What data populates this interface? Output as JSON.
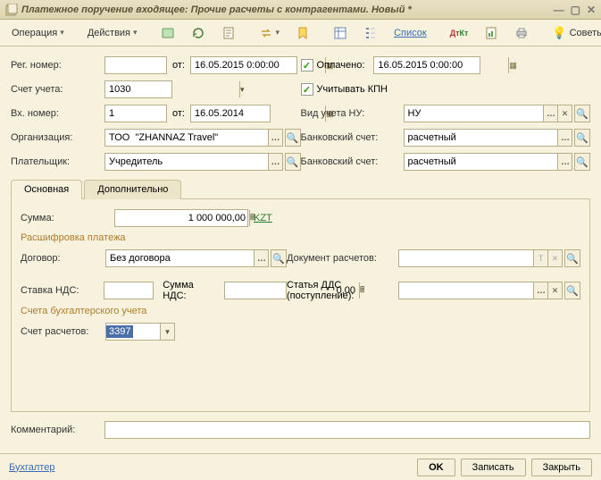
{
  "window": {
    "title": "Платежное поручение входящее: Прочие расчеты с контрагентами. Новый *"
  },
  "toolbar": {
    "operation": "Операция",
    "actions": "Действия",
    "list": "Список",
    "tips": "Советы"
  },
  "labels": {
    "reg_num": "Рег. номер:",
    "from": "от:",
    "account": "Счет учета:",
    "incoming_num": "Вх. номер:",
    "organisation": "Организация:",
    "payer": "Плательщик:",
    "paid": "Оплачено:",
    "consider_kpn": "Учитывать КПН",
    "accounting_type": "Вид учета НУ:",
    "bank_account1": "Банковский счет:",
    "bank_account2": "Банковский счет:",
    "sum": "Сумма:",
    "decipher": "Расшифровка платежа",
    "contract": "Договор:",
    "settlements_doc": "Документ расчетов:",
    "vat_rate": "Ставка НДС:",
    "vat_sum": "Сумма НДС:",
    "dds_item": "Статья ДДС",
    "dds_item_sub": "(поступление):",
    "accounts_section": "Счета бухгалтерского учета",
    "settlement_account": "Счет расчетов:",
    "comment": "Комментарий:"
  },
  "values": {
    "reg_num": "",
    "reg_date": "16.05.2015 0:00:00",
    "account": "1030",
    "incoming_num": "1",
    "incoming_date": "16.05.2014",
    "organisation": "ТОО  \"ZHANNAZ Travel\"",
    "payer": "Учредитель",
    "paid_date": "16.05.2015 0:00:00",
    "accounting_type": "НУ",
    "bank_account1": "расчетный",
    "bank_account2": "расчетный",
    "sum": "1 000 000,00",
    "currency": "KZT",
    "contract": "Без договора",
    "settlements_doc": "",
    "vat_rate": "",
    "vat_sum": "0,00",
    "dds_item": "",
    "settlement_account": "3397",
    "comment": ""
  },
  "tabs": {
    "main": "Основная",
    "additional": "Дополнительно"
  },
  "footer": {
    "account_link": "Бухгалтер",
    "ok": "OK",
    "save": "Записать",
    "close": "Закрыть"
  }
}
